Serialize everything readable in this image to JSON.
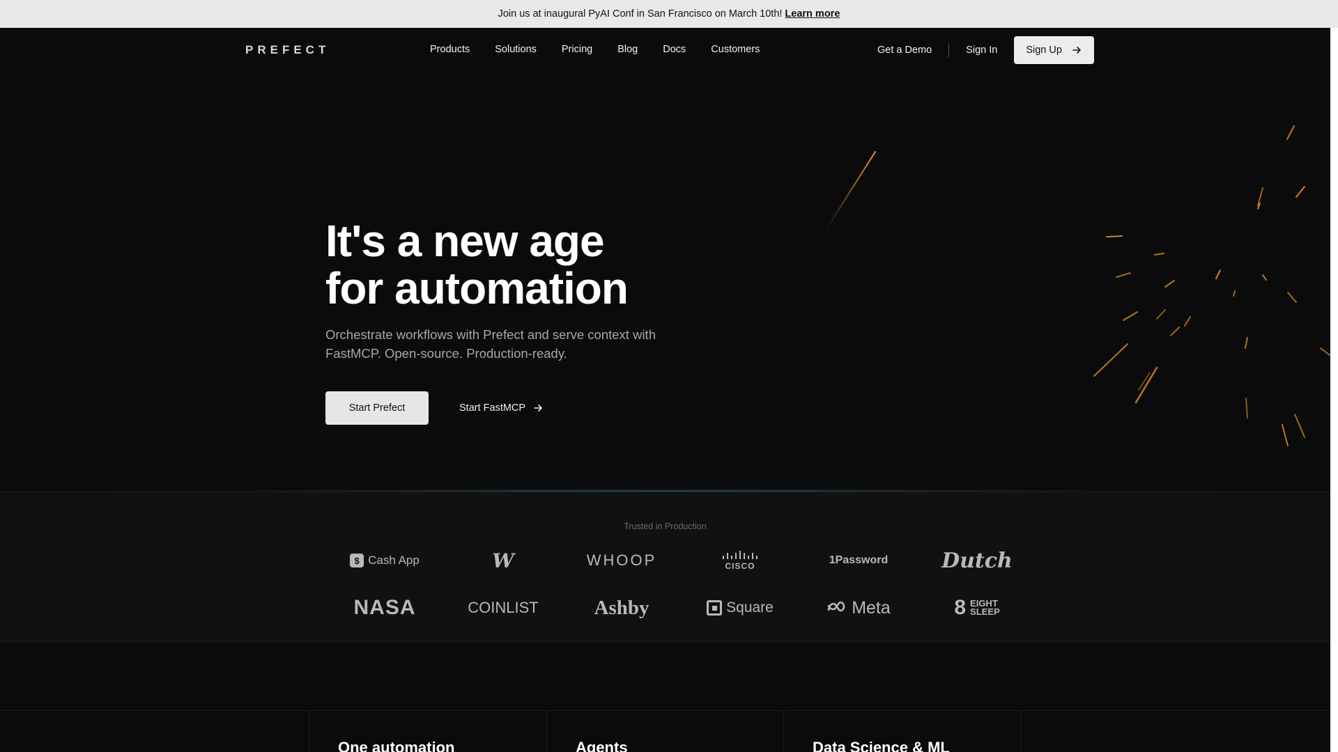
{
  "banner": {
    "text": "Join us at inaugural PyAI Conf in San Francisco on March 10th!",
    "link": "Learn more"
  },
  "nav": {
    "logo": "PREFECT",
    "links": [
      "Products",
      "Solutions",
      "Pricing",
      "Blog",
      "Docs",
      "Customers"
    ],
    "demo": "Get a Demo",
    "signin": "Sign In",
    "signup": "Sign Up"
  },
  "hero": {
    "title_line1": "It's a new age",
    "title_line2": "for automation",
    "subtitle": "Orchestrate workflows with Prefect and serve context with FastMCP. Open-source. Production-ready.",
    "primary_button": "Start Prefect",
    "secondary_button": "Start FastMCP"
  },
  "trusted": {
    "label": "Trusted in Production",
    "logos": {
      "cashapp": "Cash App",
      "washingtonpost": "W",
      "whoop": "WHOOP",
      "cisco": "CISCO",
      "onepassword": "1Password",
      "dutch": "Dutch",
      "nasa": "NASA",
      "coinlist": "COINLIST",
      "ashby": "Ashby",
      "square": "Square",
      "meta": "Meta",
      "eightsleep_line1": "EIGHT",
      "eightsleep_line2": "SLEEP"
    }
  },
  "cards": [
    "One automation",
    "Agents",
    "Data Science & ML"
  ],
  "colors": {
    "background": "#0b0b0b",
    "accent_orange": "#f5a524",
    "accent_blue": "#3aa0d8"
  }
}
